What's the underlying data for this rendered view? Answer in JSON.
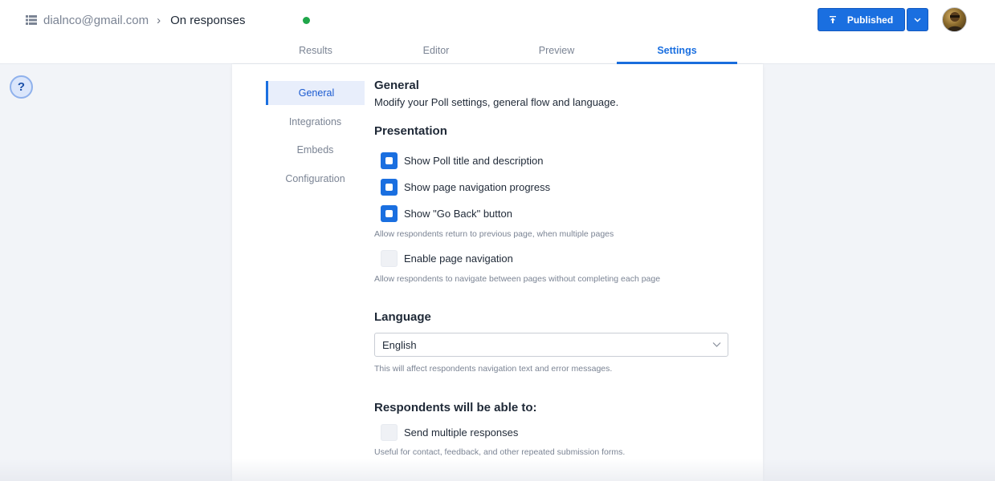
{
  "header": {
    "account": "dialnco@gmail.com",
    "page_name": "On responses",
    "publish_label": "Published"
  },
  "tabs": [
    {
      "label": "Results"
    },
    {
      "label": "Editor"
    },
    {
      "label": "Preview"
    },
    {
      "label": "Settings"
    }
  ],
  "help": {
    "label": "?"
  },
  "sidebar": {
    "items": [
      {
        "label": "General"
      },
      {
        "label": "Integrations"
      },
      {
        "label": "Embeds"
      },
      {
        "label": "Configuration"
      }
    ]
  },
  "general": {
    "title": "General",
    "subtitle": "Modify your Poll settings, general flow and language."
  },
  "presentation": {
    "title": "Presentation",
    "options": [
      {
        "label": "Show Poll title and description",
        "checked": true
      },
      {
        "label": "Show page navigation progress",
        "checked": true
      },
      {
        "label": "Show \"Go Back\" button",
        "checked": true
      },
      {
        "label": "Enable page navigation",
        "checked": false
      }
    ],
    "go_back_hint": "Allow respondents return to previous page, when multiple pages",
    "navigation_hint": "Allow respondents to navigate between pages without completing each page"
  },
  "language": {
    "title": "Language",
    "selected": "English",
    "hint": "This will affect respondents navigation text and error messages."
  },
  "respondents": {
    "title": "Respondents will be able to:",
    "option_label": "Send multiple responses",
    "option_checked": false,
    "hint": "Useful for contact, feedback, and other repeated submission forms."
  },
  "colors": {
    "accent": "#1a6fe0",
    "status_online": "#1fa64a"
  }
}
